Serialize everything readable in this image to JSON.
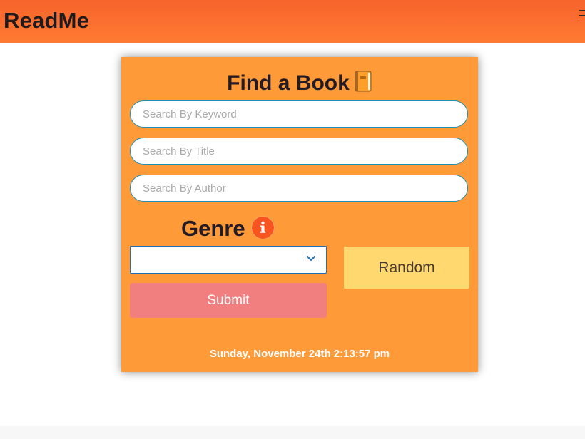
{
  "navbar": {
    "brand": "ReadMe",
    "menu_icon": "hamburger-icon"
  },
  "search_card": {
    "title": "Find a Book",
    "title_icon": "book-icon",
    "keyword_placeholder": "Search By Keyword",
    "title_placeholder": "Search By Title",
    "author_placeholder": "Search By Author",
    "genre_label": "Genre",
    "genre_info_icon": "info-icon",
    "genre_selected": "",
    "submit_label": "Submit",
    "random_label": "Random",
    "datetime": "Sunday, November 24th 2:13:57 pm"
  },
  "colors": {
    "navbar": "#f7632c",
    "card": "#ff9a38",
    "submit": "#f27f7f",
    "random": "#ffd970",
    "info": "#f9541f"
  }
}
